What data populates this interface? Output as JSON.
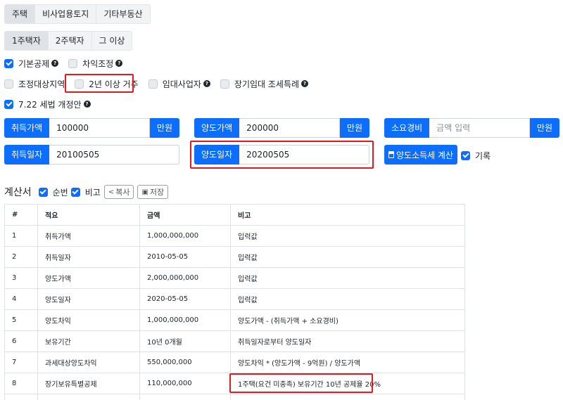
{
  "property_tabs": [
    "주택",
    "비사업용토지",
    "기타부동산"
  ],
  "house_count_tabs": [
    "1주택자",
    "2주택자",
    "그 이상"
  ],
  "options_row1": [
    {
      "label": "기본공제",
      "checked": true,
      "help": true
    },
    {
      "label": "차익조정",
      "checked": false,
      "help": true
    }
  ],
  "options_row2": [
    {
      "label": "조정대상지역",
      "checked": false,
      "help": false
    },
    {
      "label": "2년 이상 거주",
      "checked": false,
      "help": false
    },
    {
      "label": "임대사업자",
      "checked": false,
      "help": true
    },
    {
      "label": "장기임대 조세특례",
      "checked": false,
      "help": true
    }
  ],
  "options_row3": [
    {
      "label": "7.22 세법 개정안",
      "checked": true,
      "help": true
    }
  ],
  "fields": {
    "acquisition_price": {
      "label": "취득가액",
      "value": "100000",
      "unit": "만원"
    },
    "transfer_price": {
      "label": "양도가액",
      "value": "200000",
      "unit": "만원"
    },
    "expenses": {
      "label": "소요경비",
      "placeholder": "금액 입력",
      "unit": "만원"
    },
    "acquisition_date": {
      "label": "취득일자",
      "value": "20100505"
    },
    "transfer_date": {
      "label": "양도일자",
      "value": "20200505"
    }
  },
  "calc_button": "양도소득세 계산",
  "record_label": "기록",
  "record_checked": true,
  "statement": {
    "title": "계산서",
    "seq_label": "순번",
    "note_label": "비고",
    "copy_label": "복사",
    "save_label": "저장"
  },
  "table": {
    "headers": [
      "#",
      "적요",
      "금액",
      "비고"
    ],
    "rows": [
      [
        "1",
        "취득가액",
        "1,000,000,000",
        "입력값"
      ],
      [
        "2",
        "취득일자",
        "2010-05-05",
        "입력값"
      ],
      [
        "3",
        "양도가액",
        "2,000,000,000",
        "입력값"
      ],
      [
        "4",
        "양도일자",
        "2020-05-05",
        "입력값"
      ],
      [
        "5",
        "양도차익",
        "1,000,000,000",
        "양도가액 - (취득가액 + 소요경비)"
      ],
      [
        "6",
        "보유기간",
        "10년 0개월",
        "취득일자로부터 양도일자"
      ],
      [
        "7",
        "과세대상양도차익",
        "550,000,000",
        "양도차익 * (양도가액 - 9억원) / 양도가액"
      ],
      [
        "8",
        "장기보유특별공제",
        "110,000,000",
        "1주택(요건 미충족) 보유기간 10년 공제율 20%"
      ],
      [
        "",
        "",
        "",
        ""
      ]
    ]
  },
  "colors": {
    "primary": "#0d6efd",
    "highlight_border": "#e5181e"
  }
}
